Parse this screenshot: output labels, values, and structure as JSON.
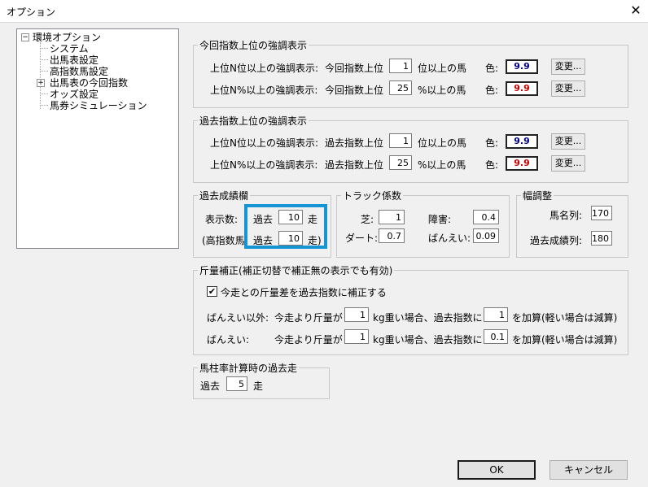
{
  "window": {
    "title": "オプション",
    "close_glyph": "✕"
  },
  "tree": {
    "root": "環境オプション",
    "items": [
      {
        "label": "システム"
      },
      {
        "label": "出馬表設定"
      },
      {
        "label": "高指数馬設定"
      },
      {
        "label": "出馬表の今回指数"
      },
      {
        "label": "オッズ設定"
      },
      {
        "label": "馬券シミュレーション"
      }
    ]
  },
  "current": {
    "legend": "今回指数上位の強調表示",
    "row1": {
      "label": "上位N位以上の強調表示:",
      "prefix": "今回指数上位",
      "value": "1",
      "suffix": "位以上の馬",
      "color_label": "色:",
      "swatch_text": "9.9",
      "swatch_color": "#00008b",
      "button": "変更..."
    },
    "row2": {
      "label": "上位N%以上の強調表示:",
      "prefix": "今回指数上位",
      "value": "25",
      "suffix": "%以上の馬",
      "color_label": "色:",
      "swatch_text": "9.9",
      "swatch_color": "#cc0000",
      "button": "変更..."
    }
  },
  "past": {
    "legend": "過去指数上位の強調表示",
    "row1": {
      "label": "上位N位以上の強調表示:",
      "prefix": "過去指数上位",
      "value": "1",
      "suffix": "位以上の馬",
      "color_label": "色:",
      "swatch_text": "9.9",
      "swatch_color": "#00008b",
      "button": "変更..."
    },
    "row2": {
      "label": "上位N%以上の強調表示:",
      "prefix": "過去指数上位",
      "value": "25",
      "suffix": "%以上の馬",
      "color_label": "色:",
      "swatch_text": "9.9",
      "swatch_color": "#cc0000",
      "button": "変更..."
    }
  },
  "history": {
    "legend": "過去成績欄",
    "row1": {
      "label": "表示数:",
      "prefix": "過去",
      "value": "10",
      "suffix": "走"
    },
    "row2": {
      "label": "(高指数馬",
      "prefix": "過去",
      "value": "10",
      "suffix": "走)"
    }
  },
  "track": {
    "legend": "トラック係数",
    "turf": {
      "label": "芝:",
      "value": "1"
    },
    "obstacle": {
      "label": "障害:",
      "value": "0.4"
    },
    "dirt": {
      "label": "ダート:",
      "value": "0.7"
    },
    "banei": {
      "label": "ばんえい:",
      "value": "0.09"
    }
  },
  "width": {
    "legend": "幅調整",
    "horse_name": {
      "label": "馬名列:",
      "value": "170"
    },
    "history": {
      "label": "過去成績列:",
      "value": "180"
    }
  },
  "weight": {
    "legend": "斤量補正(補正切替で補正無の表示でも有効)",
    "checkbox_label": "今走との斤量差を過去指数に補正する",
    "checked": true,
    "row1": {
      "label": "ばんえい以外:",
      "prefix": "今走より斤量が",
      "value1": "1",
      "mid": "kg重い場合、過去指数に",
      "value2": "1",
      "suffix": "を加算(軽い場合は減算)"
    },
    "row2": {
      "label": "ばんえい:",
      "prefix": "今走より斤量が",
      "value1": "1",
      "mid": "kg重い場合、過去指数に",
      "value2": "0.1",
      "suffix": "を加算(軽い場合は減算)"
    }
  },
  "pillar": {
    "legend": "馬柱率計算時の過去走",
    "prefix": "過去",
    "value": "5",
    "suffix": "走"
  },
  "buttons": {
    "ok": "OK",
    "cancel": "キャンセル"
  }
}
